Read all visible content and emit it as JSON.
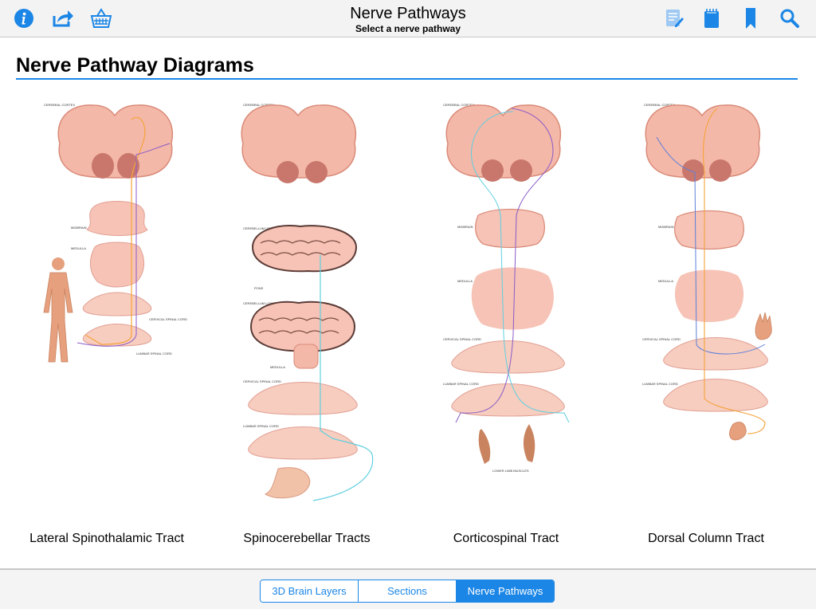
{
  "header": {
    "title": "Nerve Pathways",
    "subtitle": "Select a nerve pathway"
  },
  "toolbar_icons": [
    "info-icon",
    "share-icon",
    "basket-icon",
    "notes-icon",
    "notepad-icon",
    "bookmark-icon",
    "search-icon"
  ],
  "section": {
    "title": "Nerve Pathway Diagrams"
  },
  "diagrams": [
    {
      "caption": "Lateral Spinothalamic Tract",
      "labels": [
        "CEREBRAL CORTEX",
        "MIDBRAIN",
        "MEDULLA",
        "CERVICAL SPINAL CORD",
        "LUMBAR SPINAL CORD"
      ]
    },
    {
      "caption": "Spinocerebellar Tracts",
      "labels": [
        "CEREBRAL CORTEX",
        "CEREBELLUM UPPER",
        "PONS",
        "CEREBELLUM LOWER",
        "MEDULLA",
        "CERVICAL SPINAL CORD",
        "LUMBAR SPINAL CORD"
      ]
    },
    {
      "caption": "Corticospinal Tract",
      "labels": [
        "CEREBRAL CORTEX",
        "MIDBRAIN",
        "MEDULLA",
        "CERVICAL SPINAL CORD",
        "LUMBAR SPINAL CORD",
        "LOWER LIMB MUSCLES"
      ]
    },
    {
      "caption": "Dorsal Column Tract",
      "labels": [
        "CEREBRAL CORTEX",
        "MIDBRAIN",
        "MEDULLA",
        "CERVICAL SPINAL CORD",
        "LUMBAR SPINAL CORD"
      ]
    }
  ],
  "tabs": [
    "3D Brain Layers",
    "Sections",
    "Nerve Pathways"
  ],
  "selected_tab": "Nerve Pathways",
  "colors": {
    "accent": "#1b86e6",
    "tissue": "#f4b8a8",
    "tissue_edge": "#d98a78",
    "pathway_orange": "#f5a33a",
    "pathway_purple": "#8a5bc8",
    "pathway_cyan": "#5fcfe0"
  }
}
